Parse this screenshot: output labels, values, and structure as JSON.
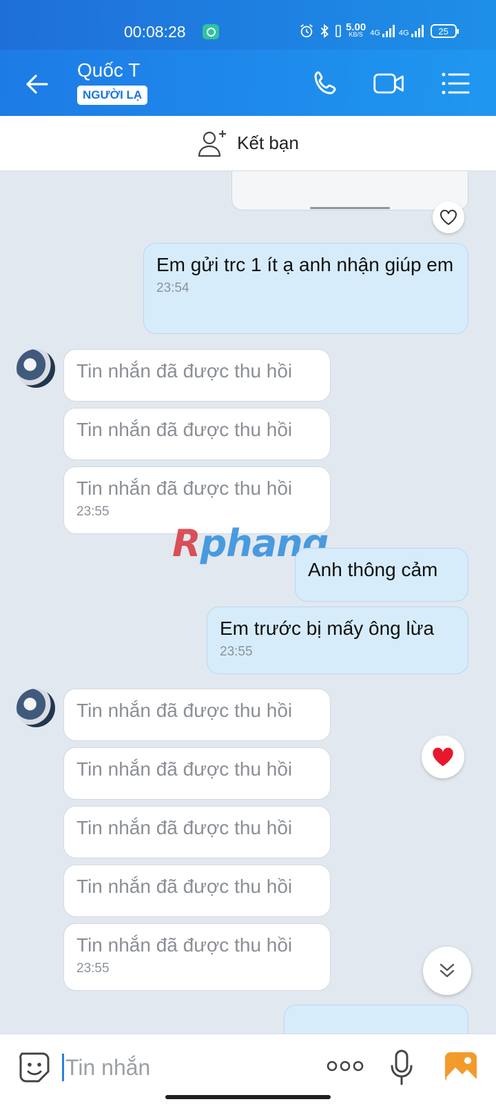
{
  "status_bar": {
    "time": "00:08:28",
    "net_speed": "5.00",
    "net_speed_unit": "KB/S",
    "net1": "4G",
    "net2": "4G",
    "battery": "25"
  },
  "header": {
    "title": "Quốc T",
    "badge": "NGƯỜI LẠ"
  },
  "add_friend": {
    "label": "Kết bạn"
  },
  "messages": [
    {
      "type": "out",
      "text": "Em gửi trc 1 ít ạ anh nhận giúp em",
      "time": "23:54"
    },
    {
      "type": "in",
      "text": "Tin nhắn đã được thu hồi"
    },
    {
      "type": "in",
      "text": "Tin nhắn đã được thu hồi"
    },
    {
      "type": "in",
      "text": "Tin nhắn đã được thu hồi",
      "time": "23:55"
    },
    {
      "type": "out",
      "text": "Anh thông cảm"
    },
    {
      "type": "out",
      "text": "Em trước bị mấy ông lừa",
      "time": "23:55"
    },
    {
      "type": "in",
      "text": "Tin nhắn đã được thu hồi"
    },
    {
      "type": "in",
      "text": "Tin nhắn đã được thu hồi"
    },
    {
      "type": "in",
      "text": "Tin nhắn đã được thu hồi"
    },
    {
      "type": "in",
      "text": "Tin nhắn đã được thu hồi"
    },
    {
      "type": "in",
      "text": "Tin nhắn đã được thu hồi",
      "time": "23:55"
    }
  ],
  "watermark": {
    "part1": "R",
    "part2": "phang"
  },
  "input": {
    "placeholder": "Tin nhắn"
  },
  "colors": {
    "accent": "#1e88e8",
    "outgoing_bubble": "#d6ecfb",
    "incoming_bubble": "#ffffff",
    "heart": "#e8182c"
  }
}
